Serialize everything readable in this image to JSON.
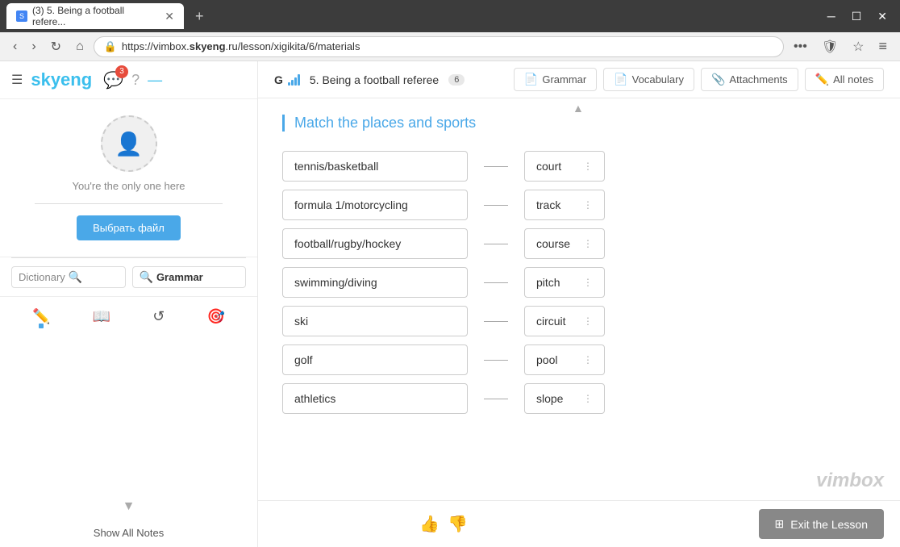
{
  "browser": {
    "tab_label": "(3) 5. Being a football refere...",
    "tab_count": "3",
    "url": "https://vimbox.skyeng.ru/lesson/xigikita/6/materials",
    "url_domain": "skyeng",
    "url_full_display": "https://vimbox.skyeng.ru/lesson/xigikita/6/materials"
  },
  "sidebar": {
    "logo": "skyeng",
    "message_badge": "3",
    "user_status": "You're the only one here",
    "upload_btn": "Выбрать файл",
    "dictionary_label": "Dictionary",
    "grammar_label": "Grammar",
    "show_notes": "Show All Notes"
  },
  "topbar": {
    "g_label": "G",
    "lesson_title": "5. Being a football referee",
    "lesson_number": "6",
    "tabs": [
      {
        "icon": "📄",
        "label": "Grammar"
      },
      {
        "icon": "📄",
        "label": "Vocabulary"
      },
      {
        "icon": "📎",
        "label": "Attachments"
      },
      {
        "icon": "✏️",
        "label": "All notes"
      }
    ]
  },
  "exercise": {
    "title": "Match the places and sports",
    "pairs": [
      {
        "left": "tennis/basketball",
        "right": "court"
      },
      {
        "left": "formula 1/motorcycling",
        "right": "track"
      },
      {
        "left": "football/rugby/hockey",
        "right": "course"
      },
      {
        "left": "swimming/diving",
        "right": "pitch"
      },
      {
        "left": "ski",
        "right": "circuit"
      },
      {
        "left": "golf",
        "right": "pool"
      },
      {
        "left": "athletics",
        "right": "slope"
      }
    ]
  },
  "bottom": {
    "exit_btn": "Exit the Lesson",
    "vimbox_logo": "vimbox"
  }
}
